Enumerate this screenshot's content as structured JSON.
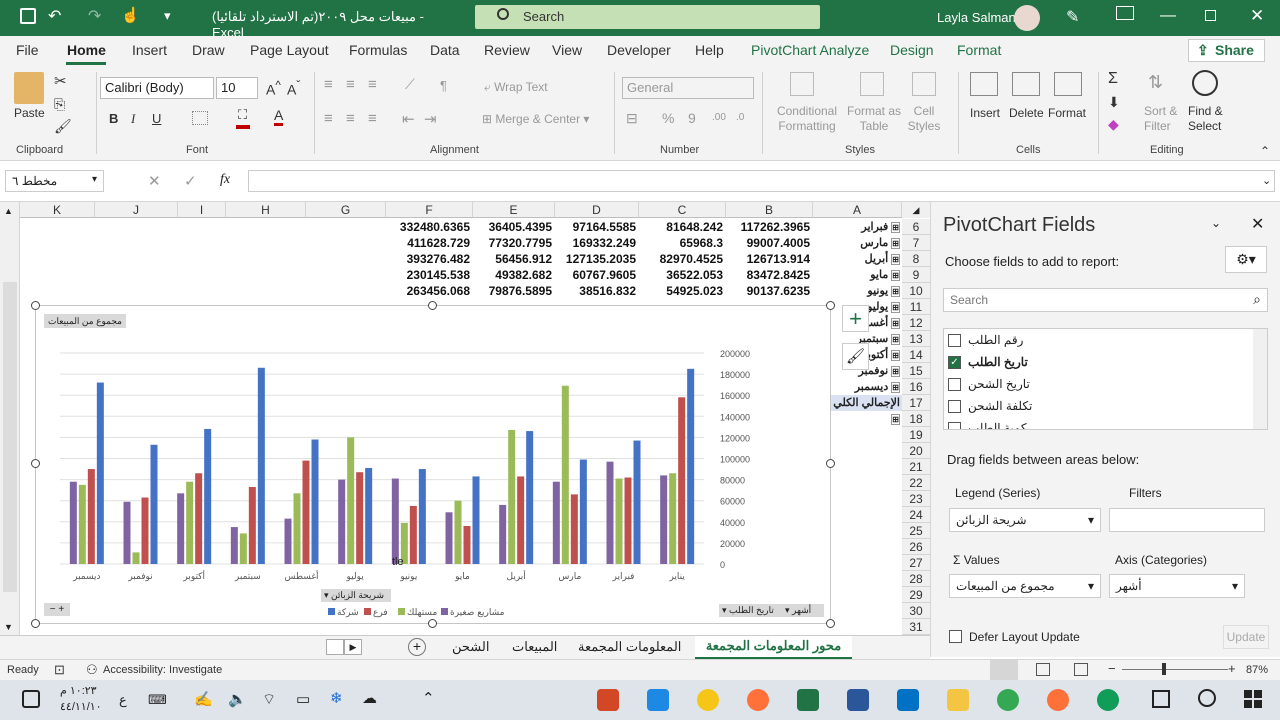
{
  "window": {
    "title": "مبيعات محل ٢٠٠٩(تم الاسترداد تلقائيا)  -  Excel",
    "search_placeholder": "Search",
    "user": "Layla Salman"
  },
  "tabs": [
    "File",
    "Home",
    "Insert",
    "Draw",
    "Page Layout",
    "Formulas",
    "Data",
    "Review",
    "View",
    "Developer",
    "Help",
    "PivotChart Analyze",
    "Design",
    "Format"
  ],
  "share_label": "Share",
  "ribbon": {
    "paste": "Paste",
    "font_name": "Calibri (Body)",
    "font_size": "10",
    "wrap_text": "Wrap Text",
    "merge_center": "Merge & Center",
    "number_format": "General",
    "conditional_formatting": "Conditional Formatting",
    "format_as_table": "Format as Table",
    "cell_styles": "Cell Styles",
    "insert": "Insert",
    "delete": "Delete",
    "format": "Format",
    "sort_filter": "Sort & Filter",
    "find_select": "Find & Select",
    "groups": [
      "Clipboard",
      "Font",
      "Alignment",
      "Number",
      "Styles",
      "Cells",
      "Editing"
    ]
  },
  "formula_bar": {
    "name_box": "مخطط ٦",
    "fx": "fx"
  },
  "grid": {
    "columns": [
      "K",
      "J",
      "I",
      "H",
      "G",
      "F",
      "E",
      "D",
      "C",
      "B",
      "A"
    ],
    "rows": [
      "6",
      "7",
      "8",
      "9",
      "10",
      "11",
      "12",
      "13",
      "14",
      "15",
      "16",
      "17",
      "18",
      "19",
      "20",
      "21",
      "22",
      "23",
      "24",
      "25",
      "26",
      "27",
      "28",
      "29",
      "30",
      "31"
    ],
    "months": [
      "فبراير",
      "مارس",
      "أبريل",
      "مايو",
      "يونيو",
      "يوليو",
      "أغسطس",
      "سبتمبر",
      "أكتوبر",
      "نوفمبر",
      "ديسمبر",
      "الإجمالي الكلي"
    ],
    "data_rows": [
      [
        "332480.6365",
        "36405.4395",
        "97164.5585",
        "81648.242",
        "117262.3965"
      ],
      [
        "411628.729",
        "77320.7795",
        "169332.249",
        "65968.3",
        "99007.4005"
      ],
      [
        "393276.482",
        "56456.912",
        "127135.2035",
        "82970.4525",
        "126713.914"
      ],
      [
        "230145.538",
        "49382.682",
        "60767.9605",
        "36522.053",
        "83472.8425"
      ],
      [
        "263456.068",
        "79876.5895",
        "38516.832",
        "54925.023",
        "90137.6235"
      ]
    ]
  },
  "chart": {
    "values_button": "مجموع من المبيعات",
    "title_fragment": "tle",
    "legend_filter": "شريحة الزبائن",
    "axis_filter_1": "تاريخ الطلب",
    "axis_filter_2": "أشهر"
  },
  "chart_data": {
    "type": "bar",
    "categories": [
      "يناير",
      "فبراير",
      "مارس",
      "أبريل",
      "مايو",
      "يونيو",
      "يوليو",
      "أغسطس",
      "سبتمبر",
      "أكتوبر",
      "نوفمبر",
      "ديسمبر"
    ],
    "series": [
      {
        "name": "شركة",
        "color": "#4472c4",
        "values": [
          185000,
          117000,
          99000,
          126000,
          83000,
          90000,
          91000,
          118000,
          186000,
          128000,
          113000,
          172000
        ]
      },
      {
        "name": "فرع",
        "color": "#c0504d",
        "values": [
          158000,
          82000,
          66000,
          83000,
          36000,
          55000,
          87000,
          98000,
          73000,
          86000,
          63000,
          90000
        ]
      },
      {
        "name": "مستهلك",
        "color": "#9bbb59",
        "values": [
          86000,
          81000,
          169000,
          127000,
          60000,
          39000,
          120000,
          67000,
          29000,
          78000,
          11000,
          75000
        ]
      },
      {
        "name": "مشاريع صغيرة",
        "color": "#8064a2",
        "values": [
          84000,
          97000,
          78000,
          56000,
          49000,
          81000,
          80000,
          43000,
          35000,
          67000,
          59000,
          78000
        ]
      }
    ],
    "ylim": [
      0,
      200000
    ],
    "yticks": [
      "200000",
      "180000",
      "160000",
      "140000",
      "120000",
      "100000",
      "80000",
      "60000",
      "40000",
      "20000",
      "0"
    ]
  },
  "pane": {
    "title": "PivotChart Fields",
    "subtitle": "Choose fields to add to report:",
    "search_placeholder": "Search",
    "fields": [
      {
        "label": "رقم الطلب",
        "checked": false
      },
      {
        "label": "تاريخ الطلب",
        "checked": true
      },
      {
        "label": "تاريخ الشحن",
        "checked": false
      },
      {
        "label": "تكلفة الشحن",
        "checked": false
      },
      {
        "label": "كمية الطلب",
        "checked": false
      }
    ],
    "drag_label": "Drag fields between areas below:",
    "legend_label": "Legend (Series)",
    "filters_label": "Filters",
    "legend_value": "شريحة الزبائن",
    "values_label": "Values",
    "axis_label": "Axis (Categories)",
    "values_value": "مجموع من المبيعات",
    "axis_value": "أشهر",
    "defer_label": "Defer Layout Update",
    "update_label": "Update"
  },
  "sheet_tabs": [
    "محور المعلومات المجمعة",
    "المعلومات المجمعة",
    "المبيعات",
    "الشحن"
  ],
  "status": {
    "ready": "Ready",
    "accessibility": "Accessibility: Investigate",
    "zoom": "87%"
  },
  "taskbar": {
    "time": "١٠:٢٣ م",
    "date": "٤٤/١١/١٠",
    "lang": "ع"
  }
}
